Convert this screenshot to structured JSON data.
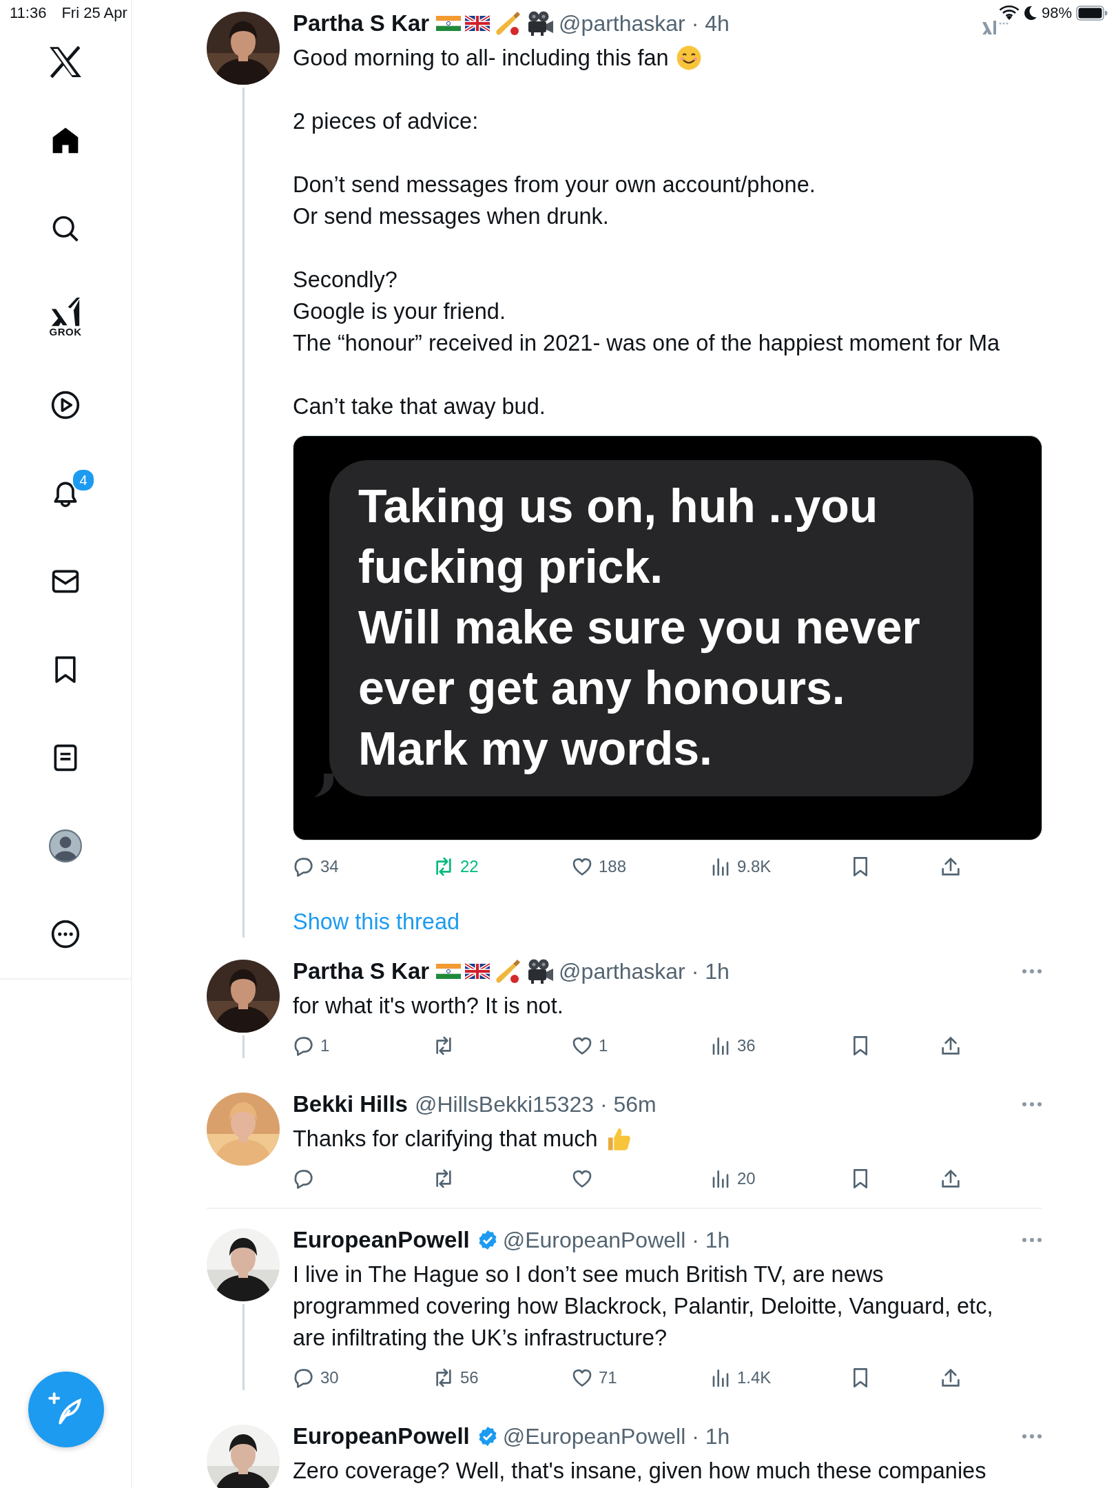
{
  "status_bar": {
    "time": "11:36",
    "date": "Fri 25 Apr",
    "battery": "98%"
  },
  "sidebar": {
    "items": [
      {
        "kind": "home",
        "selected": true
      },
      {
        "kind": "search",
        "selected": false
      },
      {
        "kind": "grok",
        "label": "GROK",
        "selected": false
      },
      {
        "kind": "video",
        "selected": false
      },
      {
        "kind": "notifications",
        "badge": "4",
        "selected": false
      },
      {
        "kind": "messages",
        "selected": false
      },
      {
        "kind": "bookmarks",
        "selected": false
      },
      {
        "kind": "lists",
        "selected": false
      },
      {
        "kind": "profile",
        "selected": false
      },
      {
        "kind": "more",
        "selected": false
      }
    ]
  },
  "tweets": [
    {
      "avatar": {
        "kind": "picture"
      },
      "name": "Partha S Kar",
      "author_emoji": true,
      "verified": false,
      "meta": "@parthaskar · 4h",
      "more_menu": false,
      "thread_line": true,
      "paragraphs": [
        {
          "kind": "text-with-smile",
          "lines": [
            "Good morning to all- including this fan"
          ]
        },
        {
          "lines": [
            "2 pieces of advice:"
          ]
        },
        {
          "lines": [
            "Don’t send messages from your own account/phone.",
            "Or send messages when drunk."
          ]
        },
        {
          "lines": [
            "Secondly?",
            "Google is your friend.",
            "The “honour” received in 2021- was one of the happiest moment for Ma"
          ]
        },
        {
          "lines": [
            "Can’t take that away bud."
          ]
        }
      ],
      "media": {
        "kind": "message-screenshot",
        "lines": [
          "Taking us on, huh ..you",
          "fucking prick.",
          "Will make sure you never",
          "ever get any honours.",
          "Mark my words."
        ]
      },
      "actions": [
        {
          "kind": "reply",
          "count": "34",
          "active": false
        },
        {
          "kind": "repost",
          "count": "22",
          "active": true
        },
        {
          "kind": "like",
          "count": "188",
          "active": false
        },
        {
          "kind": "views",
          "count": "9.8K",
          "active": false
        },
        {
          "kind": "bookmark",
          "active": false
        },
        {
          "kind": "share",
          "active": false
        }
      ],
      "thread_link": "Show this thread",
      "divider_after": false
    },
    {
      "avatar": {
        "kind": "picture"
      },
      "name": "Partha S Kar",
      "author_emoji": true,
      "verified": false,
      "meta": "@parthaskar · 1h",
      "more_menu": true,
      "thread_line": true,
      "paragraphs": [
        {
          "lines": [
            "for what it's worth? It is not."
          ]
        }
      ],
      "actions": [
        {
          "kind": "reply",
          "count": "1",
          "active": false
        },
        {
          "kind": "repost",
          "active": false
        },
        {
          "kind": "like",
          "count": "1",
          "active": false
        },
        {
          "kind": "views",
          "count": "36",
          "active": false
        },
        {
          "kind": "bookmark",
          "active": false
        },
        {
          "kind": "share",
          "active": false
        }
      ],
      "divider_after": false
    },
    {
      "avatar": {
        "kind": "picture"
      },
      "name": "Bekki Hills",
      "author_emoji": false,
      "verified": false,
      "meta": "@HillsBekki15323 · 56m",
      "more_menu": true,
      "thread_line": false,
      "paragraphs": [
        {
          "kind": "text-with-thumbs-up",
          "lines": [
            "Thanks for clarifying that much"
          ]
        }
      ],
      "actions": [
        {
          "kind": "reply",
          "active": false
        },
        {
          "kind": "repost",
          "active": false
        },
        {
          "kind": "like",
          "active": false
        },
        {
          "kind": "views",
          "count": "20",
          "active": false
        },
        {
          "kind": "bookmark",
          "active": false
        },
        {
          "kind": "share",
          "active": false
        }
      ],
      "divider_after": true
    },
    {
      "avatar": {
        "kind": "picture"
      },
      "name": "EuropeanPowell",
      "author_emoji": false,
      "verified": true,
      "meta": "@EuropeanPowell · 1h",
      "more_menu": true,
      "thread_line": true,
      "paragraphs": [
        {
          "lines": [
            "I live in The Hague so I don’t see much British TV, are news",
            "programmed covering how Blackrock, Palantir, Deloitte, Vanguard, etc,",
            "are infiltrating the UK’s infrastructure?"
          ]
        }
      ],
      "actions": [
        {
          "kind": "reply",
          "count": "30",
          "active": false
        },
        {
          "kind": "repost",
          "count": "56",
          "active": false
        },
        {
          "kind": "like",
          "count": "71",
          "active": false
        },
        {
          "kind": "views",
          "count": "1.4K",
          "active": false
        },
        {
          "kind": "bookmark",
          "active": false
        },
        {
          "kind": "share",
          "active": false
        }
      ],
      "divider_after": false
    },
    {
      "avatar": {
        "kind": "picture"
      },
      "name": "EuropeanPowell",
      "author_emoji": false,
      "verified": true,
      "meta": "@EuropeanPowell · 1h",
      "more_menu": true,
      "thread_line": false,
      "paragraphs": [
        {
          "lines": [
            "Zero coverage? Well, that's insane, given how much these companies"
          ]
        }
      ],
      "divider_after": false
    }
  ]
}
